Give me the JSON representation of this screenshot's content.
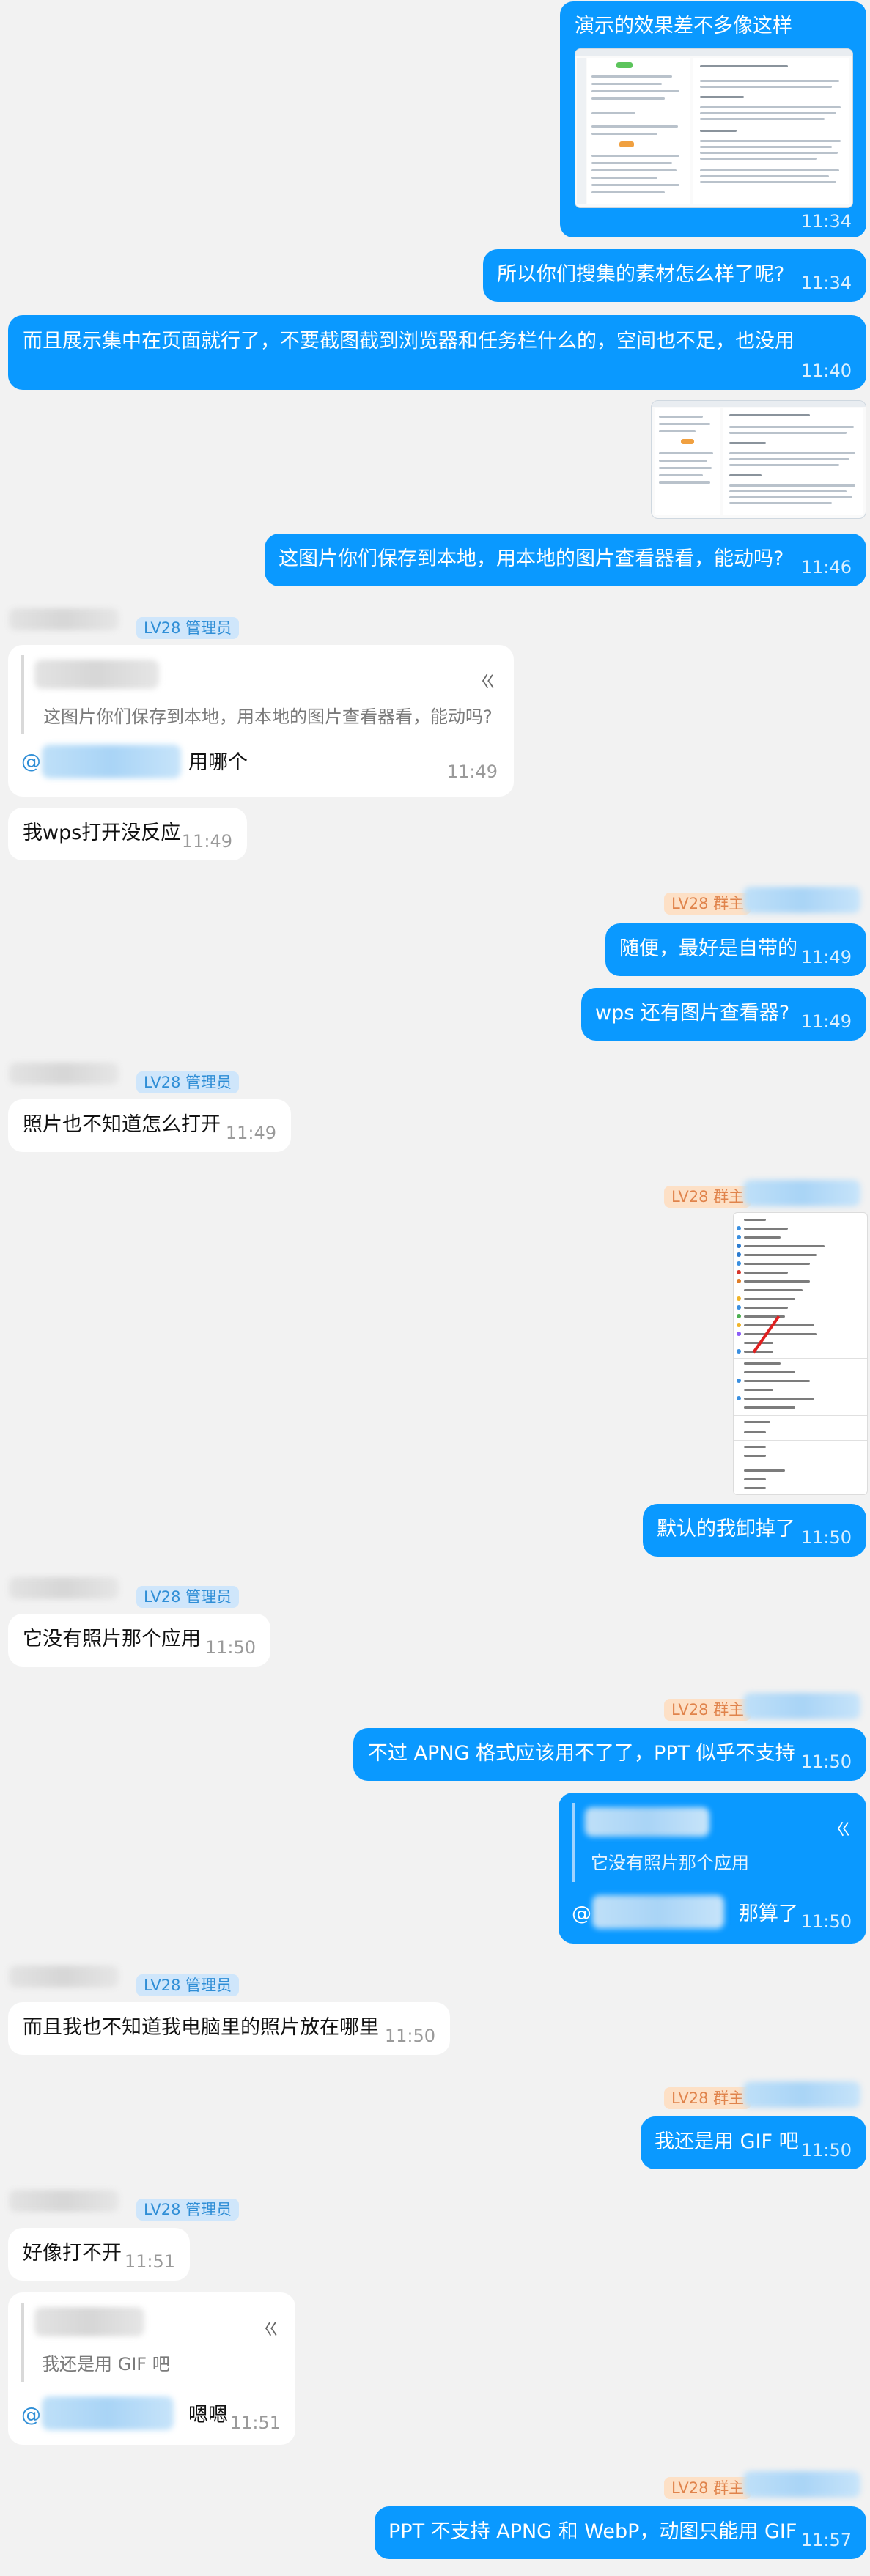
{
  "roles": {
    "admin": "LV28 管理员",
    "owner": "LV28 群主"
  },
  "quote_close": "ㄍ",
  "messages": {
    "m1": {
      "text": "演示的效果差不多像这样",
      "time": "11:34"
    },
    "m2": {
      "text": "所以你们搜集的素材怎么样了呢?",
      "time": "11:34"
    },
    "m3": {
      "text": "而且展示集中在页面就行了，不要截图截到浏览器和任务栏什么的，空间也不足，也没用",
      "time": "11:40"
    },
    "m4": {
      "text": "这图片你们保存到本地，用本地的图片查看器看，能动吗?",
      "time": "11:46"
    },
    "m5": {
      "quote": "这图片你们保存到本地，用本地的图片查看器看，能动吗?",
      "mention": "@",
      "text": "用哪个",
      "time": "11:49"
    },
    "m6": {
      "text": "我wps打开没反应",
      "time": "11:49"
    },
    "m7": {
      "text": "随便，最好是自带的",
      "time": "11:49"
    },
    "m8": {
      "text": "wps 还有图片查看器?",
      "time": "11:49"
    },
    "m9": {
      "text": "照片也不知道怎么打开",
      "time": "11:49"
    },
    "m10": {
      "text": "默认的我卸掉了",
      "time": "11:50"
    },
    "m11": {
      "text": "它没有照片那个应用",
      "time": "11:50"
    },
    "m12": {
      "text": "不过 APNG 格式应该用不了了，PPT 似乎不支持",
      "time": "11:50"
    },
    "m13": {
      "quote": "它没有照片那个应用",
      "mention": "@",
      "text": "那算了",
      "time": "11:50"
    },
    "m14": {
      "text": "而且我也不知道我电脑里的照片放在哪里",
      "time": "11:50"
    },
    "m15": {
      "text": "我还是用 GIF 吧",
      "time": "11:50"
    },
    "m16": {
      "text": "好像打不开",
      "time": "11:51"
    },
    "m17": {
      "quote": "我还是用 GIF 吧",
      "mention": "@",
      "text": "嗯嗯",
      "time": "11:51"
    },
    "m18": {
      "text": "PPT 不支持 APNG 和 WebP，动图只能用 GIF",
      "time": "11:57"
    }
  }
}
